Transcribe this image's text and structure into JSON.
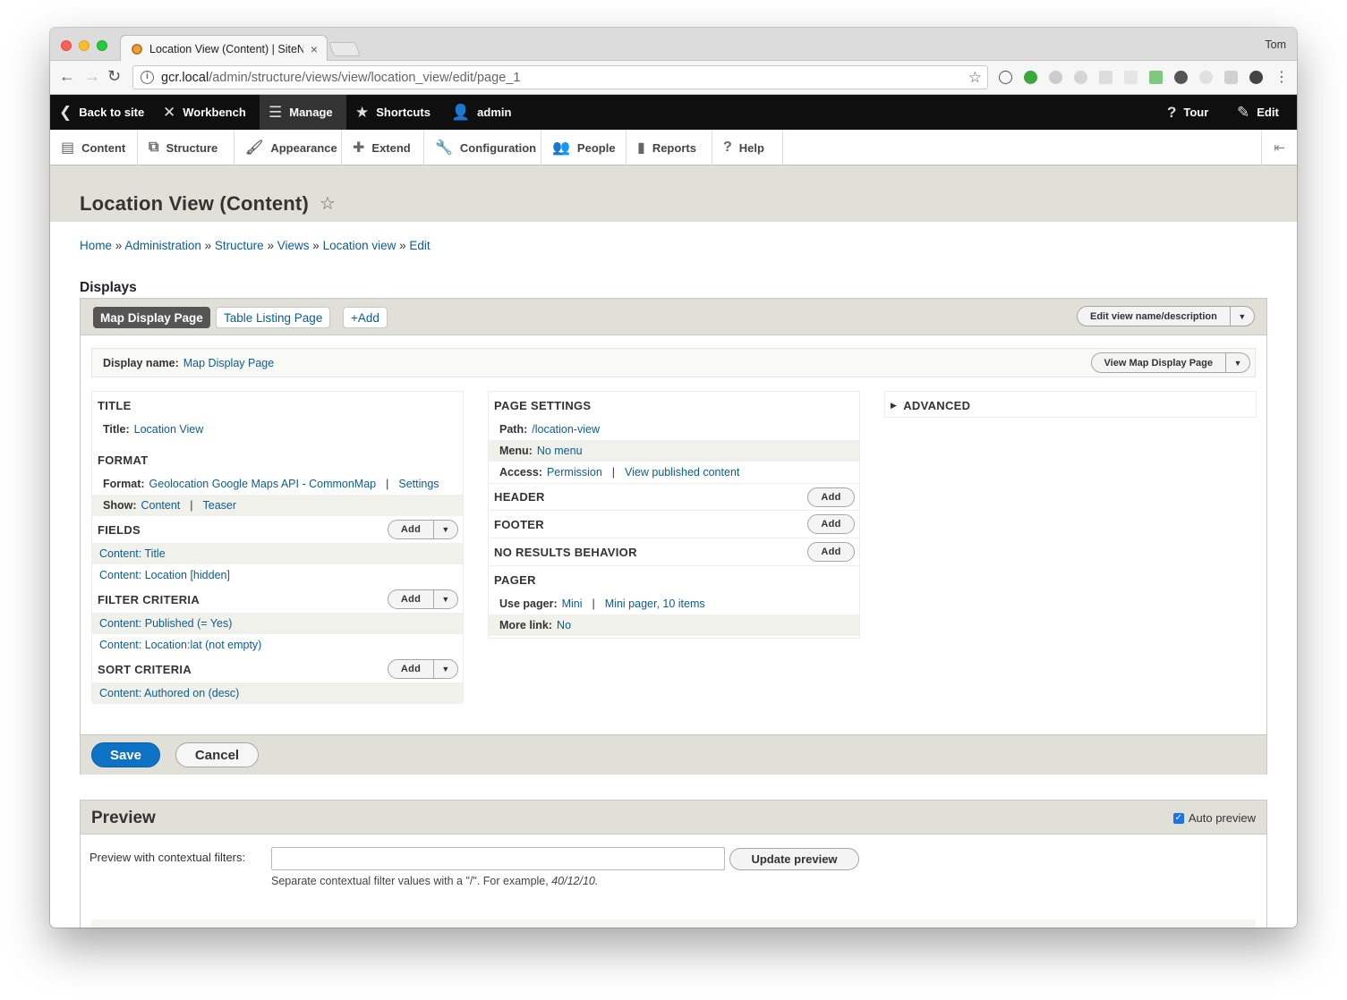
{
  "browser": {
    "tab_title": "Location View (Content) | SiteN",
    "profile": "Tom",
    "url_host": "gcr.local",
    "url_path": "/admin/structure/views/view/location_view/edit/page_1"
  },
  "admin_bar": {
    "back": "Back to site",
    "workbench": "Workbench",
    "manage": "Manage",
    "shortcuts": "Shortcuts",
    "user": "admin",
    "tour": "Tour",
    "edit": "Edit"
  },
  "tray": [
    "Content",
    "Structure",
    "Appearance",
    "Extend",
    "Configuration",
    "People",
    "Reports",
    "Help"
  ],
  "page_title": "Location View (Content)",
  "breadcrumb": [
    "Home",
    "Administration",
    "Structure",
    "Views",
    "Location view",
    "Edit"
  ],
  "breadcrumb_sep": "»",
  "displays_label": "Displays",
  "display_tabs": {
    "active": "Map Display Page",
    "second": "Table Listing Page",
    "add": "+Add",
    "edit_name": "Edit view name/description"
  },
  "display_name": {
    "label": "Display name:",
    "value": "Map Display Page",
    "view_button": "View Map Display Page"
  },
  "col1": {
    "title_heading": "TITLE",
    "title_label": "Title:",
    "title_value": "Location View",
    "format_heading": "FORMAT",
    "format_label": "Format:",
    "format_value": "Geolocation Google Maps API - CommonMap",
    "format_settings": "Settings",
    "show_label": "Show:",
    "show_value": "Content",
    "show_mode": "Teaser",
    "fields_heading": "FIELDS",
    "fields": [
      "Content: Title",
      "Content: Location [hidden]"
    ],
    "filter_heading": "FILTER CRITERIA",
    "filters": [
      "Content: Published (= Yes)",
      "Content: Location:lat (not empty)"
    ],
    "sort_heading": "SORT CRITERIA",
    "sorts": [
      "Content: Authored on (desc)"
    ],
    "add": "Add"
  },
  "col2": {
    "page_heading": "PAGE SETTINGS",
    "path_label": "Path:",
    "path_value": "/location-view",
    "menu_label": "Menu:",
    "menu_value": "No menu",
    "access_label": "Access:",
    "access_value": "Permission",
    "access_perm": "View published content",
    "header_heading": "HEADER",
    "footer_heading": "FOOTER",
    "noresults_heading": "NO RESULTS BEHAVIOR",
    "pager_heading": "PAGER",
    "pager_label": "Use pager:",
    "pager_value": "Mini",
    "pager_detail": "Mini pager, 10 items",
    "more_label": "More link:",
    "more_value": "No",
    "add": "Add"
  },
  "col3": {
    "advanced_heading": "ADVANCED"
  },
  "actions": {
    "save": "Save",
    "cancel": "Cancel"
  },
  "preview": {
    "title": "Preview",
    "auto_preview": "Auto preview",
    "ctx_label": "Preview with contextual filters:",
    "ctx_value": "",
    "update_button": "Update preview",
    "help_prefix": "Separate contextual filter values with a \"/\". For example, ",
    "help_example": "40/12/10."
  },
  "colors": {
    "drupal_blue": "#0f73c5",
    "link": "#0d5c91",
    "header_bg": "#e0e0d8",
    "admin_bar": "#0f0f0f"
  }
}
